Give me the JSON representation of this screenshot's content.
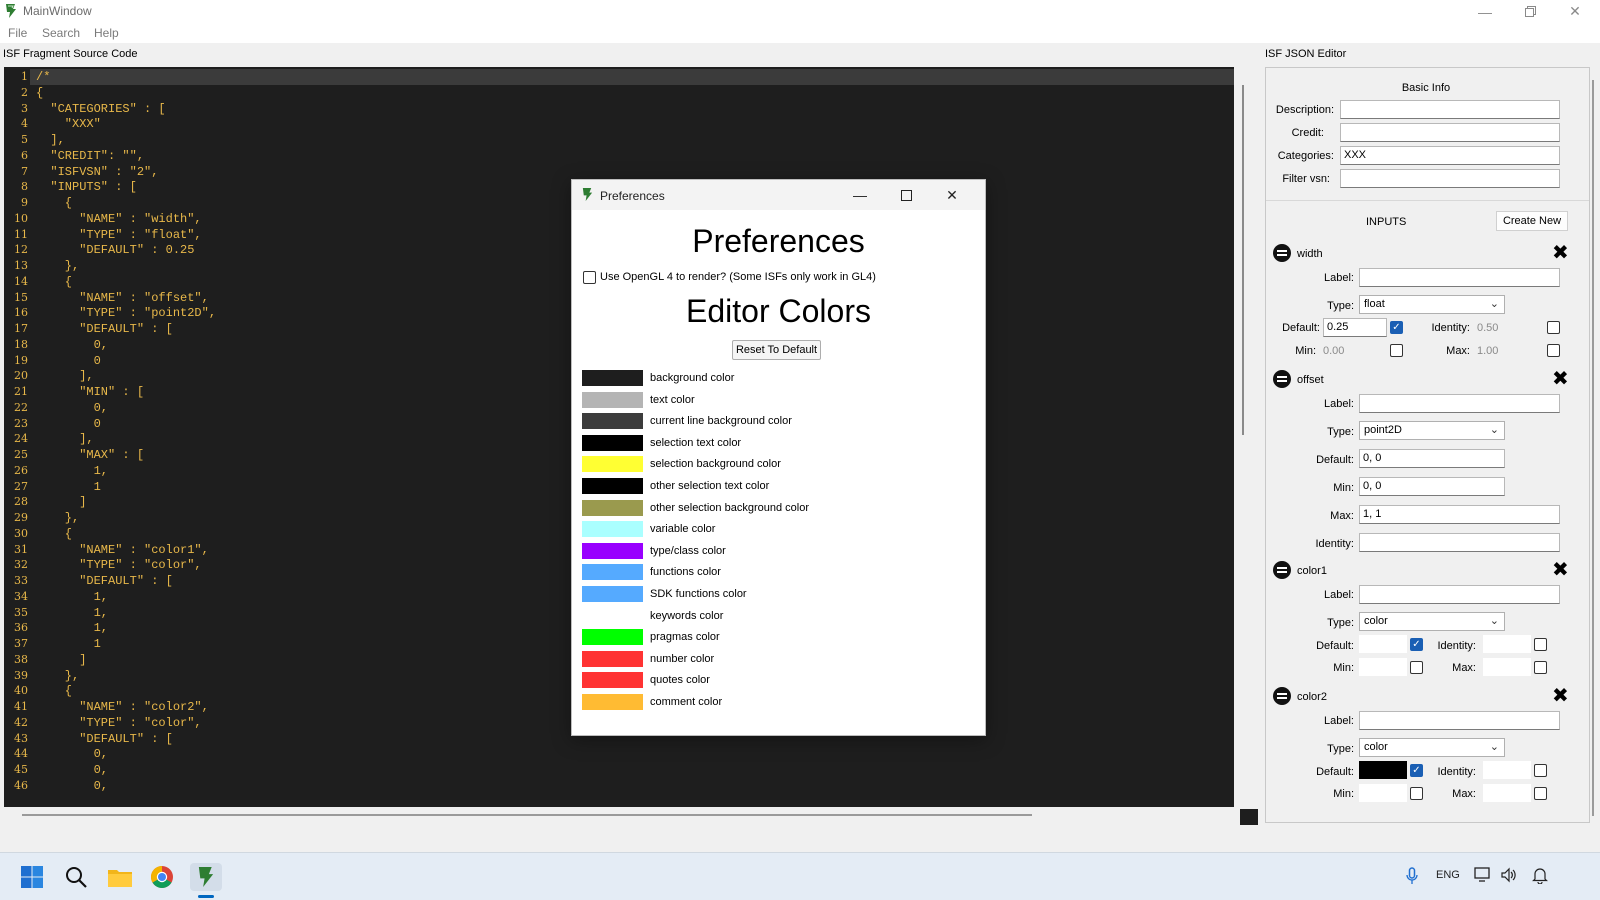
{
  "window": {
    "title": "MainWindow"
  },
  "menu": [
    "File",
    "Search",
    "Help"
  ],
  "left_pane_label": "ISF Fragment Source Code",
  "right_pane_label": "ISF JSON Editor",
  "code_lines": [
    "/*",
    "{",
    "  \"CATEGORIES\" : [",
    "    \"XXX\"",
    "  ],",
    "  \"CREDIT\": \"\",",
    "  \"ISFVSN\" : \"2\",",
    "  \"INPUTS\" : [",
    "    {",
    "      \"NAME\" : \"width\",",
    "      \"TYPE\" : \"float\",",
    "      \"DEFAULT\" : 0.25",
    "    },",
    "    {",
    "      \"NAME\" : \"offset\",",
    "      \"TYPE\" : \"point2D\",",
    "      \"DEFAULT\" : [",
    "        0,",
    "        0",
    "      ],",
    "      \"MIN\" : [",
    "        0,",
    "        0",
    "      ],",
    "      \"MAX\" : [",
    "        1,",
    "        1",
    "      ]",
    "    },",
    "    {",
    "      \"NAME\" : \"color1\",",
    "      \"TYPE\" : \"color\",",
    "      \"DEFAULT\" : [",
    "        1,",
    "        1,",
    "        1,",
    "        1",
    "      ]",
    "    },",
    "    {",
    "      \"NAME\" : \"color2\",",
    "      \"TYPE\" : \"color\",",
    "      \"DEFAULT\" : [",
    "        0,",
    "        0,",
    "        0,"
  ],
  "json_editor": {
    "basic_info_title": "Basic Info",
    "description_label": "Description:",
    "description_value": "",
    "credit_label": "Credit:",
    "credit_value": "",
    "categories_label": "Categories:",
    "categories_value": "XXX",
    "filter_vsn_label": "Filter vsn:",
    "filter_vsn_value": "",
    "inputs_title": "INPUTS",
    "create_new_label": "Create New",
    "label_label": "Label:",
    "type_label": "Type:",
    "default_label": "Default:",
    "identity_label": "Identity:",
    "min_label": "Min:",
    "max_label": "Max:",
    "inputs": [
      {
        "name": "width",
        "type": "float",
        "default": "0.25",
        "identity": "0.50",
        "min": "0.00",
        "max": "1.00"
      },
      {
        "name": "offset",
        "type": "point2D",
        "default": "0, 0",
        "min": "0, 0",
        "max": "1, 1",
        "identity": ""
      },
      {
        "name": "color1",
        "type": "color"
      },
      {
        "name": "color2",
        "type": "color"
      }
    ]
  },
  "preferences": {
    "window_title": "Preferences",
    "heading": "Preferences",
    "opengl_label": "Use OpenGL 4 to render?  (Some ISFs only work in GL4)",
    "opengl_checked": false,
    "editor_colors_heading": "Editor Colors",
    "reset_label": "Reset To Default",
    "colors": [
      {
        "label": "background color",
        "color": "#1e1e1e"
      },
      {
        "label": "text color",
        "color": "#b4b4b4"
      },
      {
        "label": "current line background color",
        "color": "#3c3c3c"
      },
      {
        "label": "selection text color",
        "color": "#000000"
      },
      {
        "label": "selection background color",
        "color": "#ffff33"
      },
      {
        "label": "other selection text color",
        "color": "#000000"
      },
      {
        "label": "other selection background color",
        "color": "#9a9a4e"
      },
      {
        "label": "variable color",
        "color": "#aaffff"
      },
      {
        "label": "type/class color",
        "color": "#9900ff"
      },
      {
        "label": "functions color",
        "color": "#55aaff"
      },
      {
        "label": "SDK functions color",
        "color": "#55aaff"
      },
      {
        "label": "keywords color",
        "color": "#ffffff"
      },
      {
        "label": "pragmas color",
        "color": "#00ff00"
      },
      {
        "label": "number color",
        "color": "#ff3333"
      },
      {
        "label": "quotes color",
        "color": "#ff3333"
      },
      {
        "label": "comment color",
        "color": "#ffbb33"
      }
    ]
  },
  "taskbar": {
    "items": [
      "start-icon",
      "search-icon",
      "file-explorer-icon",
      "chrome-icon",
      "isf-editor-icon"
    ],
    "language": "ENG"
  },
  "colors": {
    "editor_background": "#1e1e1e",
    "code_text": "#e8b84a",
    "checkbox_checked": "#1a5fb4"
  }
}
